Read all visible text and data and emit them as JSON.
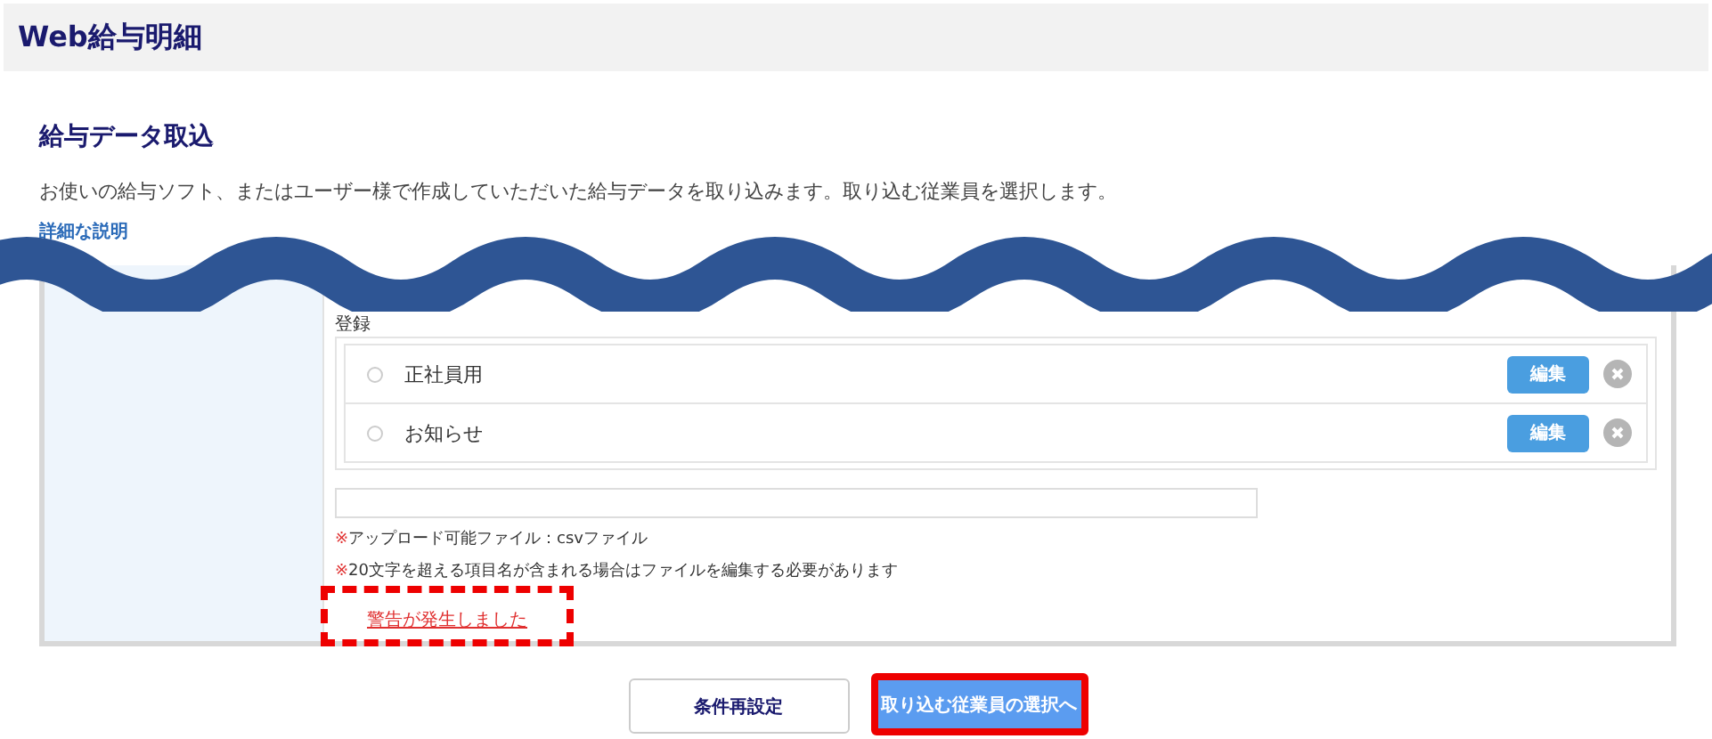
{
  "header": {
    "title": "Web給与明細"
  },
  "page": {
    "title": "給与データ取込",
    "description": "お使いの給与ソフト、またはユーザー様で作成していただいた給与データを取り込みます。取り込む従業員を選択します。",
    "link": "詳細な説明"
  },
  "panel": {
    "list_label": "登録",
    "templates": [
      {
        "name": "正社員用",
        "selected": false,
        "edit": "編集"
      },
      {
        "name": "お知らせ",
        "selected": false,
        "edit": "編集"
      }
    ],
    "notes": [
      {
        "mark": "※",
        "text": "アップロード可能ファイル：csvファイル"
      },
      {
        "mark": "※",
        "text": "20文字を超える項目名が含まれる場合はファイルを編集する必要があります"
      }
    ],
    "warning": {
      "text": "警告が発生しました",
      "highlighted": true
    }
  },
  "buttons": [
    {
      "label": "条件再設定",
      "kind": "secondary",
      "highlighted": false
    },
    {
      "label": "取り込む従業員の選択へ",
      "kind": "primary",
      "highlighted": true
    }
  ]
}
